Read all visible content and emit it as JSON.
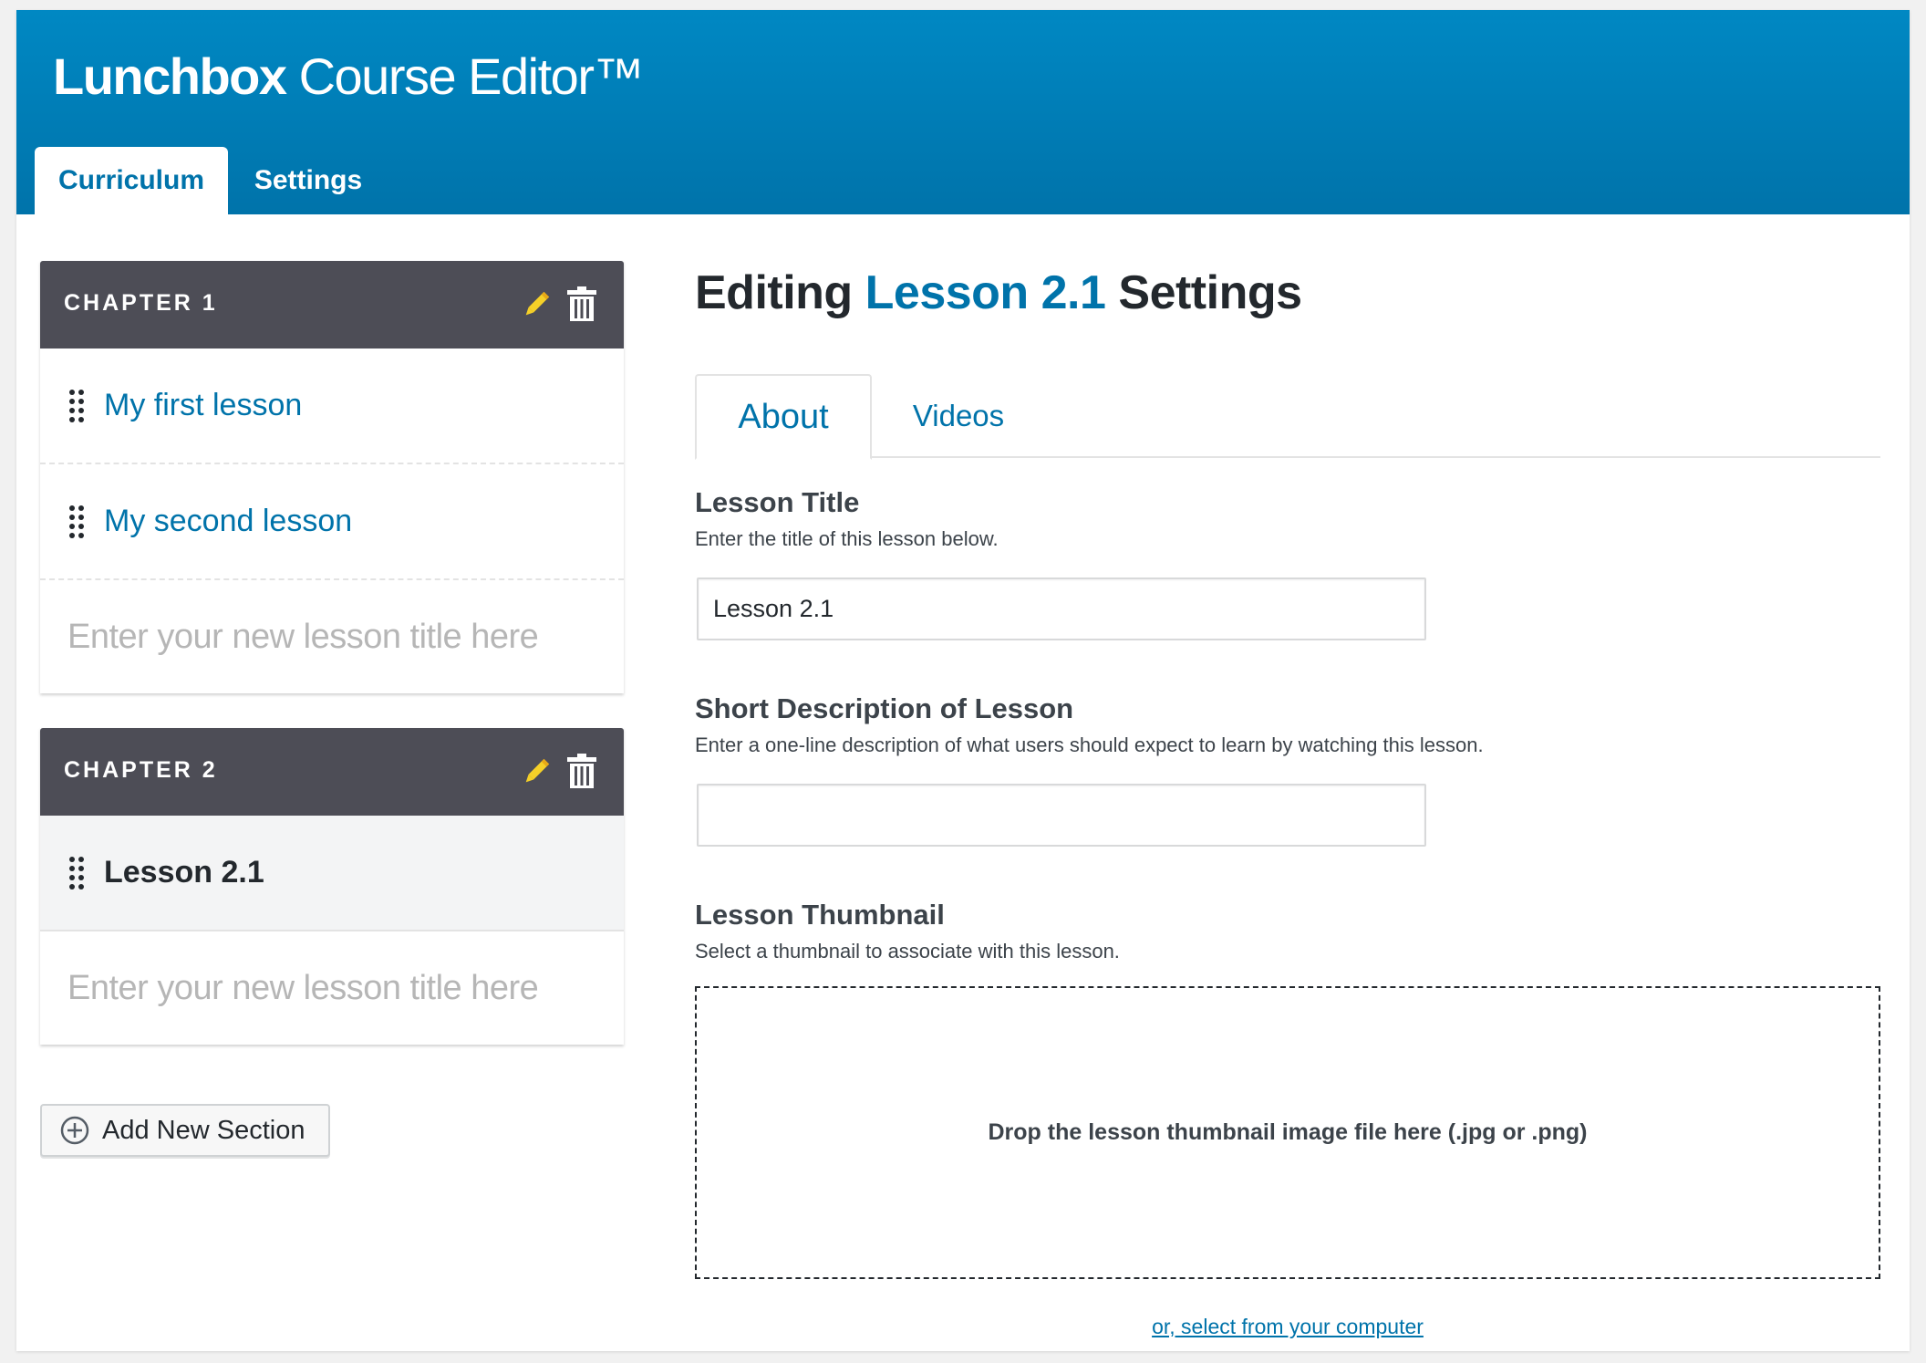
{
  "app": {
    "brand_bold": "Lunchbox",
    "brand_light": "Course Editor™"
  },
  "main_tabs": [
    {
      "label": "Curriculum",
      "active": true
    },
    {
      "label": "Settings",
      "active": false
    }
  ],
  "chapters": [
    {
      "title": "CHAPTER 1",
      "lessons": [
        "My first lesson",
        "My second lesson"
      ],
      "new_lesson_placeholder": "Enter your new lesson title here"
    },
    {
      "title": "CHAPTER 2",
      "lessons": [
        "Lesson 2.1"
      ],
      "selected_lesson": "Lesson 2.1",
      "new_lesson_placeholder": "Enter your new lesson title here"
    }
  ],
  "add_section_label": "Add New Section",
  "editor": {
    "title_prefix": "Editing",
    "title_highlight": "Lesson 2.1",
    "title_suffix": "Settings",
    "tabs": [
      {
        "label": "About",
        "active": true
      },
      {
        "label": "Videos",
        "active": false
      }
    ],
    "fields": {
      "lesson_title": {
        "label": "Lesson Title",
        "help": "Enter the title of this lesson below.",
        "value": "Lesson 2.1"
      },
      "short_description": {
        "label": "Short Description of Lesson",
        "help": "Enter a one-line description of what users should expect to learn by watching this lesson.",
        "value": ""
      },
      "thumbnail": {
        "label": "Lesson Thumbnail",
        "help": "Select a thumbnail to associate with this lesson.",
        "dropzone_text": "Drop the lesson thumbnail image file here (.jpg or .png)",
        "select_link": "or, select from your computer"
      }
    }
  },
  "colors": {
    "header": "#0073aa",
    "chapter_header": "#4d4d56",
    "link": "#0073aa",
    "pencil": "#f5d028"
  },
  "icons": [
    "pencil-icon",
    "trash-icon",
    "drag-handle-icon",
    "plus-circle-icon"
  ]
}
